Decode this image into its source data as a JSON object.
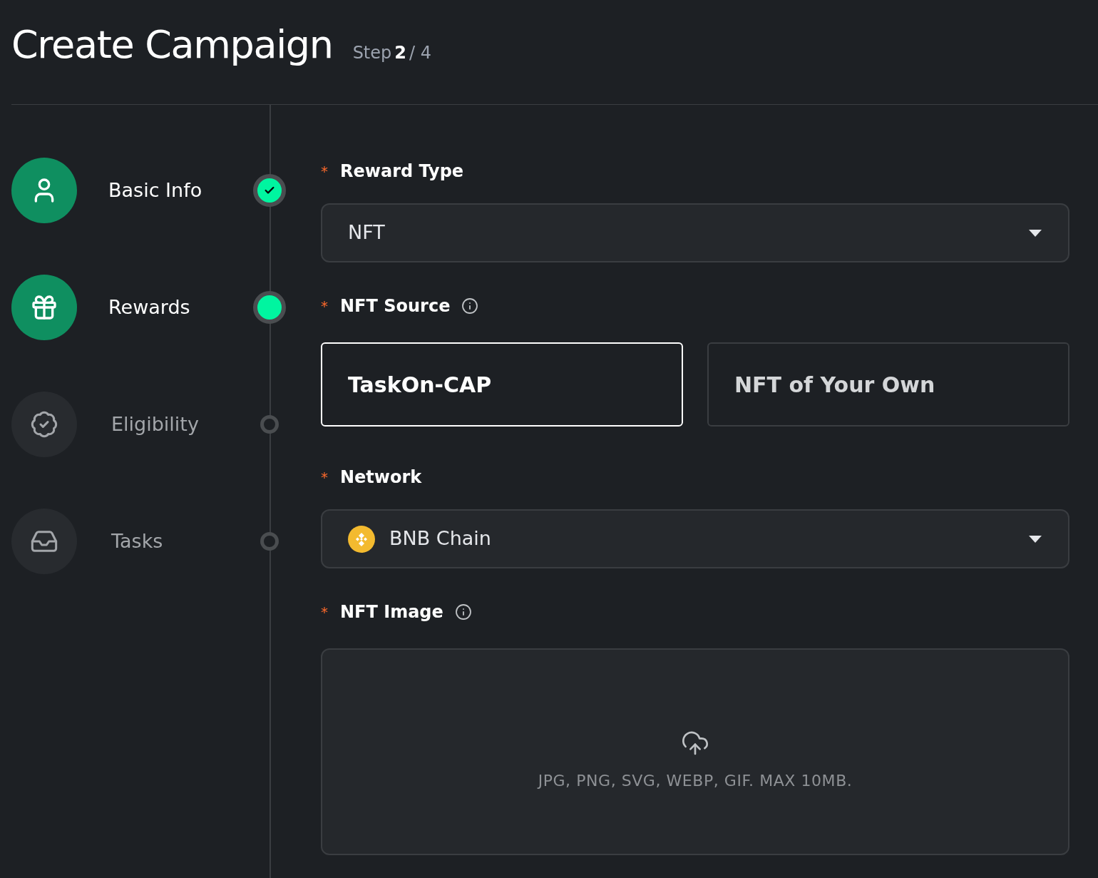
{
  "header": {
    "title": "Create Campaign",
    "step_label": "Step",
    "step_current": "2",
    "step_total": "/ 4"
  },
  "steps": [
    {
      "label": "Basic Info",
      "kind": "user",
      "completed": true,
      "active": false
    },
    {
      "label": "Rewards",
      "kind": "gift",
      "completed": false,
      "active": true
    },
    {
      "label": "Eligibility",
      "kind": "badge",
      "completed": false,
      "active": false
    },
    {
      "label": "Tasks",
      "kind": "inbox",
      "completed": false,
      "active": false
    }
  ],
  "form": [
    {
      "kind": "select",
      "label": "Reward Type",
      "required_mark": "*",
      "info": false,
      "value": "NFT"
    },
    {
      "kind": "choice",
      "label": "NFT Source",
      "required_mark": "*",
      "info": true,
      "options": [
        {
          "label": "TaskOn-CAP",
          "selected": true
        },
        {
          "label": "NFT of Your Own",
          "selected": false
        }
      ]
    },
    {
      "kind": "chain_select",
      "label": "Network",
      "required_mark": "*",
      "info": false,
      "value": "BNB Chain"
    },
    {
      "kind": "upload",
      "label": "NFT Image",
      "required_mark": "*",
      "info": true,
      "hint": "JPG, PNG, SVG, WEBP, GIF. MAX 10MB."
    }
  ]
}
